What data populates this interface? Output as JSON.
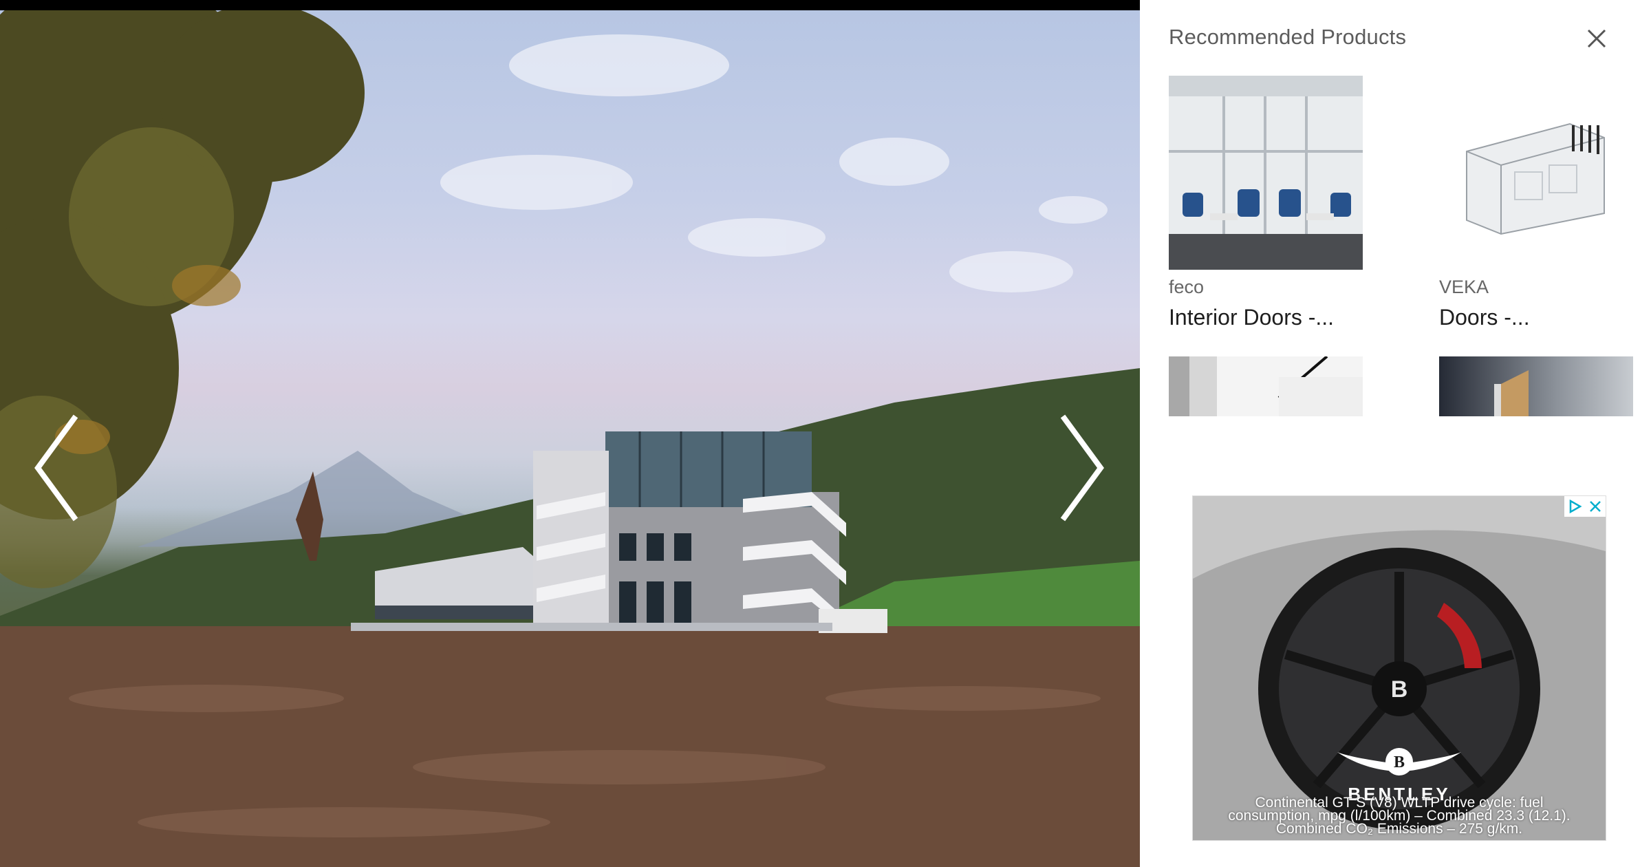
{
  "gallery": {
    "photo_description_icon": "architecture-photo",
    "prev_icon": "chevron-left-icon",
    "next_icon": "chevron-right-icon"
  },
  "sidebar": {
    "title": "Recommended Products",
    "close_icon": "close-icon",
    "products": [
      {
        "brand": "feco",
        "name": "Interior Doors -..."
      },
      {
        "brand": "VEKA",
        "name": "Doors -..."
      },
      {
        "brand": "",
        "name": ""
      },
      {
        "brand": "",
        "name": ""
      }
    ]
  },
  "ad": {
    "brand": "BENTLEY",
    "disclaimer_line1": "Continental GT S (V8) WLTP drive cycle: fuel",
    "disclaimer_line2": "consumption, mpg (l/100km) – Combined 23.3 (12.1).",
    "disclaimer_line3": "Combined CO₂ Emissions – 275 g/km.",
    "adchoices_icon": "adchoices-icon",
    "close_icon": "ad-close-icon"
  },
  "colors": {
    "sidebar_bg": "#ffffff",
    "gallery_bg": "#000000",
    "title_text": "#5c5c5c",
    "name_text": "#1e1e1e"
  }
}
